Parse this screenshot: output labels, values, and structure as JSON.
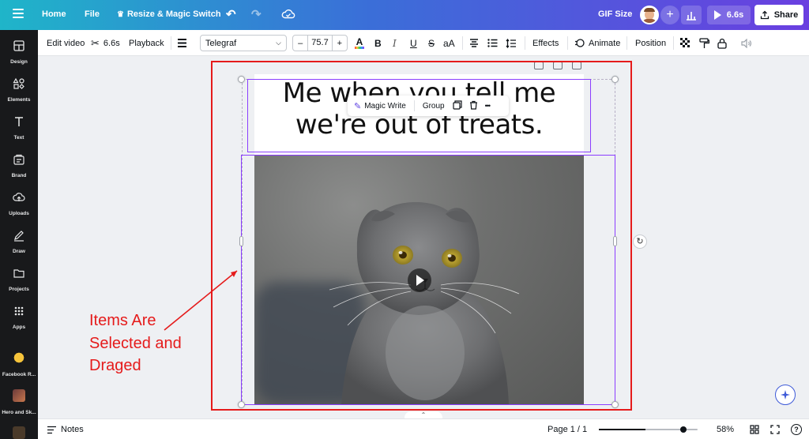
{
  "topbar": {
    "home": "Home",
    "file": "File",
    "resize": "Resize & Magic Switch",
    "gif_size": "GIF Size",
    "duration": "6.6s",
    "share": "Share"
  },
  "sidebar": {
    "items": [
      {
        "label": "Design"
      },
      {
        "label": "Elements"
      },
      {
        "label": "Text"
      },
      {
        "label": "Brand"
      },
      {
        "label": "Uploads"
      },
      {
        "label": "Draw"
      },
      {
        "label": "Projects"
      },
      {
        "label": "Apps"
      },
      {
        "label": "Facebook R..."
      },
      {
        "label": "Hero and Sk..."
      }
    ]
  },
  "toolbar": {
    "edit_video": "Edit video",
    "split_duration": "6.6s",
    "playback": "Playback",
    "font": "Telegraf",
    "font_size": "75.7",
    "minus": "–",
    "plus": "+",
    "bold": "B",
    "italic": "I",
    "underline": "U",
    "strike": "S",
    "case": "aA",
    "effects": "Effects",
    "animate": "Animate",
    "position": "Position"
  },
  "canvas": {
    "caption": "Me when you tell me we're out of treats.",
    "context_menu": {
      "magic_write": "Magic Write",
      "group": "Group",
      "more": "•••"
    },
    "annotation": "Items Are Selected and Draged"
  },
  "bottombar": {
    "notes": "Notes",
    "page": "Page 1 / 1",
    "zoom_percent": "58%",
    "zoom_level": 0.58,
    "help": "?"
  },
  "colors": {
    "accent": "#8b3dff",
    "annotation_red": "#e51b1b",
    "topbar_start": "#1fb5c9",
    "topbar_end": "#6a3fe0"
  }
}
